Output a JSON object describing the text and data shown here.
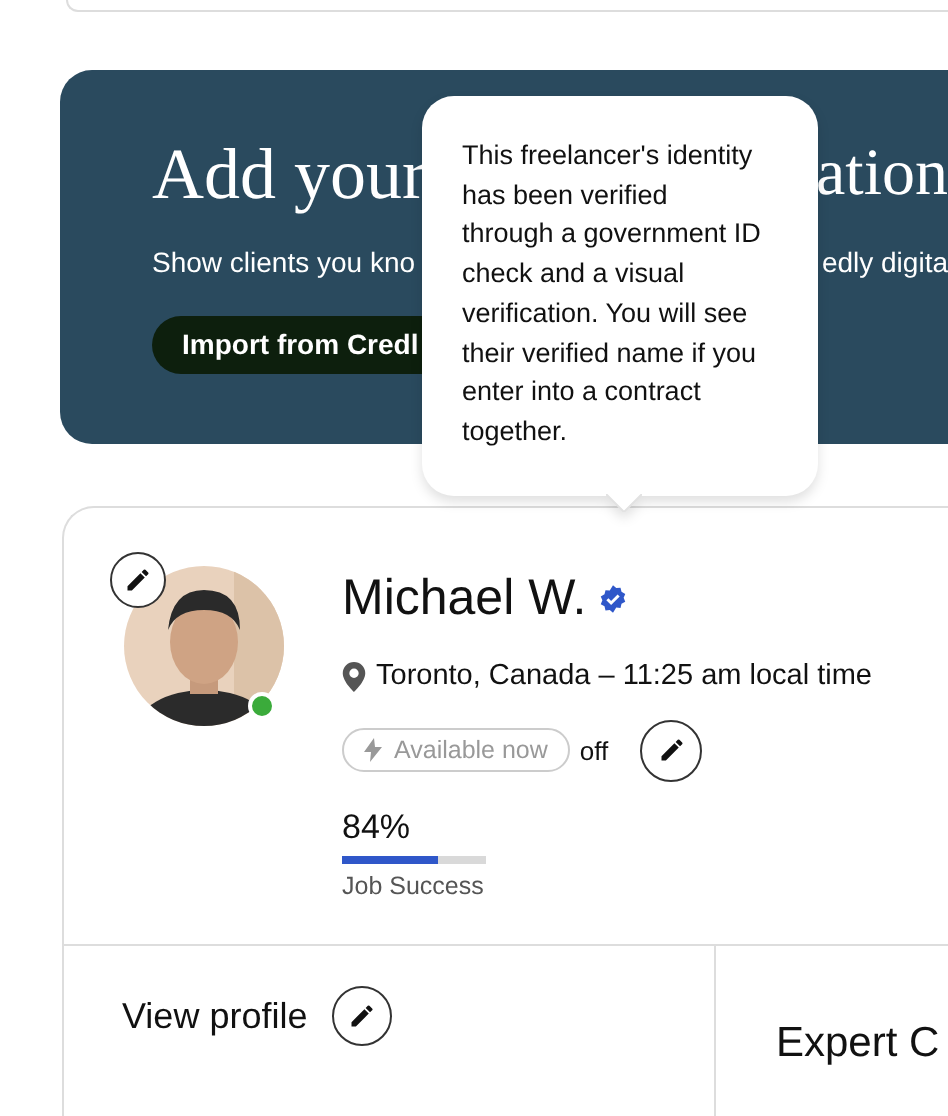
{
  "banner": {
    "heading_left": "Add your",
    "heading_right": "ation",
    "text_left": "Show clients you kno",
    "text_right": "edly digita",
    "button": "Import from Credl"
  },
  "tooltip": {
    "text": "This freelancer's identity has been verified through a government ID check and a visual verification. You will see their verified name if you enter into a contract together."
  },
  "profile": {
    "name": "Michael W.",
    "verified": true,
    "online": true,
    "location": "Toronto, Canada – 11:25 am local time",
    "availability": {
      "label": "Available now",
      "on": false,
      "status": "off"
    },
    "job_success": {
      "value": "84%",
      "level": 0.67,
      "label": "Job Success"
    }
  },
  "sections": [
    {
      "label": "View profile",
      "editable": true
    },
    {
      "label": "Expert C",
      "editable": false
    }
  ]
}
